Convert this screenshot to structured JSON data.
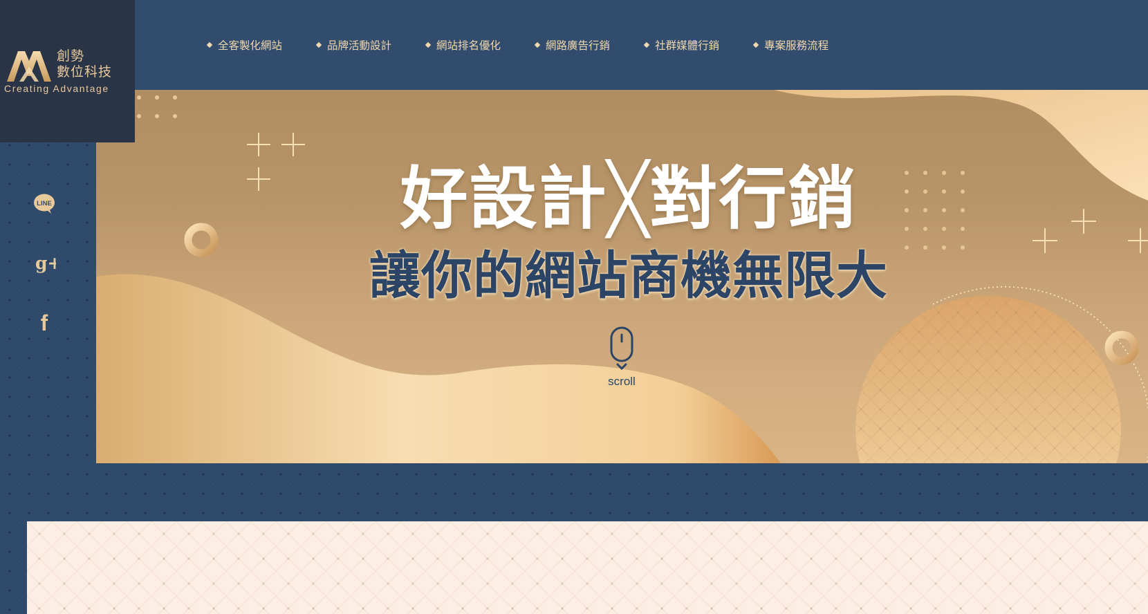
{
  "brand": {
    "name_line1": "創勢",
    "name_line2": "數位科技",
    "tagline": "Creating  Advantage"
  },
  "nav": {
    "items": [
      {
        "label": "全客製化網站"
      },
      {
        "label": "品牌活動設計"
      },
      {
        "label": "網站排名優化"
      },
      {
        "label": "網路廣告行銷"
      },
      {
        "label": "社群媒體行銷"
      },
      {
        "label": "專案服務流程"
      }
    ]
  },
  "social": {
    "items": [
      {
        "icon": "line-icon",
        "label": "LINE"
      },
      {
        "icon": "google-plus-icon",
        "label": "g+"
      },
      {
        "icon": "facebook-icon",
        "label": "f"
      }
    ]
  },
  "hero": {
    "headline": "好設計╳對行銷",
    "subheadline": "讓你的網站商機無限大",
    "scroll_label": "scroll"
  },
  "colors": {
    "navy": "#324c6d",
    "logo_bg": "#2a3447",
    "gold": "#e8c99a",
    "panel": "#fdeee3"
  }
}
